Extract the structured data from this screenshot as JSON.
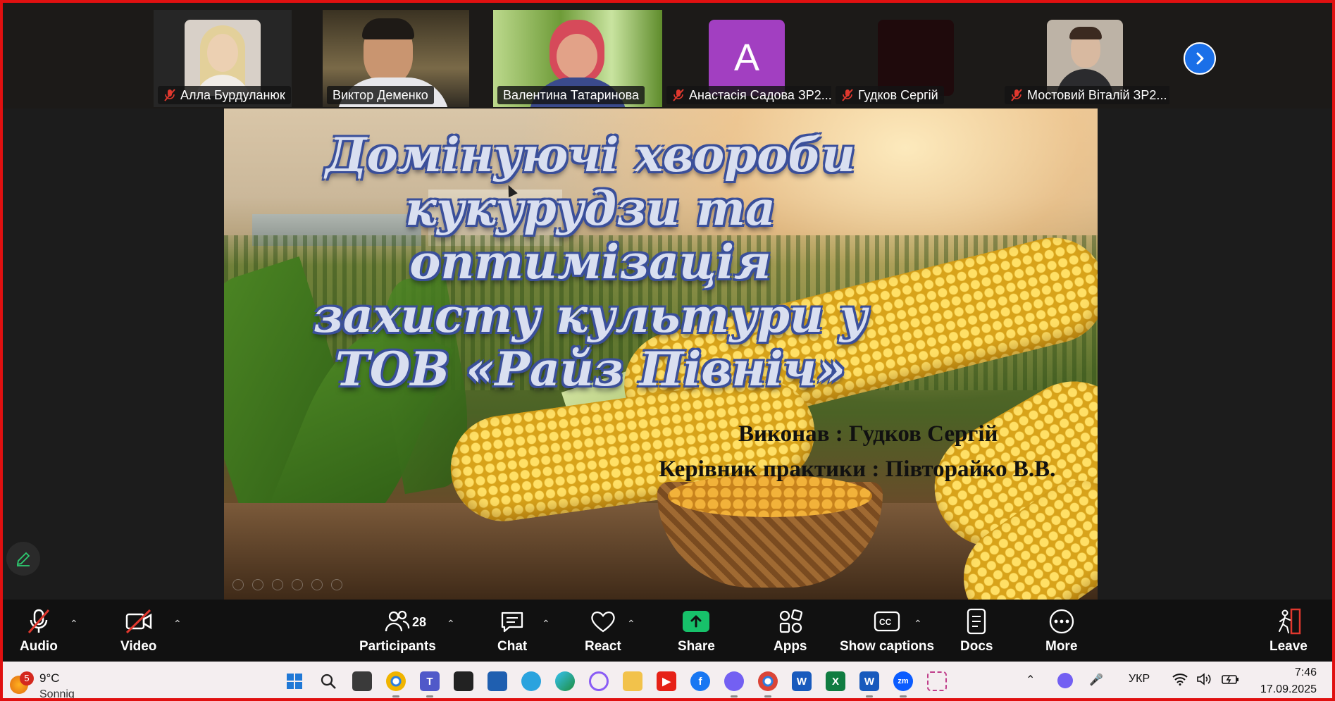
{
  "gallery": {
    "participants": [
      {
        "name": "Алла Бурдуланюк",
        "muted": true,
        "type": "photo",
        "skin": "#e8c9a8",
        "hair": "#e3d09a",
        "bg": "#d8d0c8"
      },
      {
        "name": "Виктор Деменко",
        "muted": false,
        "type": "video",
        "bg": "#6b5a3a"
      },
      {
        "name": "Валентина Татаринова",
        "muted": false,
        "type": "video",
        "active": true,
        "bg": "#7fa64e"
      },
      {
        "name": "Анастасія Садова ЗР2...",
        "muted": true,
        "type": "initial",
        "initial": "A",
        "bg": "#a23fc1"
      },
      {
        "name": "Гудков Сергій",
        "muted": true,
        "type": "dark",
        "bg": "#1f0a0c"
      },
      {
        "name": "Мостовий Віталій ЗР2...",
        "muted": true,
        "type": "photo",
        "skin": "#d8b9a0",
        "hair": "#3b2a20",
        "bg": "#bdb3a6"
      }
    ],
    "next_icon": "chevron-right-icon"
  },
  "slide": {
    "title_lines": [
      "Домінуючі хвороби",
      "кукурудзи та оптимізація",
      "захисту культури у",
      "ТОВ «Райз Північ»"
    ],
    "author": "Виконав : Гудков Сергій",
    "supervisor": "Керівник практики : Півторайко В.В."
  },
  "toolbar": {
    "audio": "Audio",
    "video": "Video",
    "participants": "Participants",
    "participants_count": "28",
    "chat": "Chat",
    "react": "React",
    "share": "Share",
    "apps": "Apps",
    "captions": "Show captions",
    "docs": "Docs",
    "more": "More",
    "leave": "Leave",
    "share_color": "#17c16a",
    "leave_color": "#e0382e"
  },
  "taskbar": {
    "weather_badge": "5",
    "temperature": "9°C",
    "condition": "Sonnig",
    "language": "УКР",
    "time": "7:46",
    "date": "17.09.2025"
  }
}
